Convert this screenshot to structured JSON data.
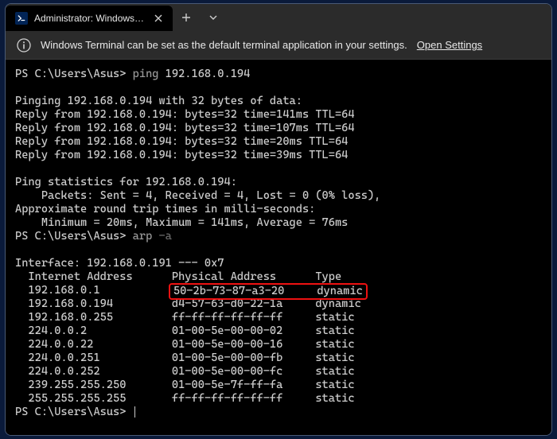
{
  "tab": {
    "title": "Administrator: Windows PowerS"
  },
  "infobar": {
    "message": "Windows Terminal can be set as the default terminal application in your settings.",
    "link": "Open Settings"
  },
  "session": {
    "prompt": "PS C:\\Users\\Asus>",
    "cmd_ping": "ping",
    "ping_target": "192.168.0.194",
    "ping_header": "Pinging 192.168.0.194 with 32 bytes of data:",
    "ping_replies": [
      "Reply from 192.168.0.194: bytes=32 time=141ms TTL=64",
      "Reply from 192.168.0.194: bytes=32 time=107ms TTL=64",
      "Reply from 192.168.0.194: bytes=32 time=20ms TTL=64",
      "Reply from 192.168.0.194: bytes=32 time=39ms TTL=64"
    ],
    "ping_stats_title": "Ping statistics for 192.168.0.194:",
    "ping_stats_packets": "    Packets: Sent = 4, Received = 4, Lost = 0 (0% loss),",
    "ping_rtt_title": "Approximate round trip times in milli-seconds:",
    "ping_rtt": "    Minimum = 20ms, Maximum = 141ms, Average = 76ms",
    "cmd_arp": "arp",
    "arp_flag": "-a",
    "arp_interface": "Interface: 192.168.0.191 --- 0x7",
    "arp_header": {
      "col1": "Internet Address",
      "col2": "Physical Address",
      "col3": "Type"
    },
    "arp_rows": [
      {
        "ip": "192.168.0.1",
        "mac": "50-2b-73-87-a3-20",
        "type": "dynamic",
        "highlight": true
      },
      {
        "ip": "192.168.0.194",
        "mac": "d4-57-63-d0-22-1a",
        "type": "dynamic",
        "highlight": false
      },
      {
        "ip": "192.168.0.255",
        "mac": "ff-ff-ff-ff-ff-ff",
        "type": "static",
        "highlight": false
      },
      {
        "ip": "224.0.0.2",
        "mac": "01-00-5e-00-00-02",
        "type": "static",
        "highlight": false
      },
      {
        "ip": "224.0.0.22",
        "mac": "01-00-5e-00-00-16",
        "type": "static",
        "highlight": false
      },
      {
        "ip": "224.0.0.251",
        "mac": "01-00-5e-00-00-fb",
        "type": "static",
        "highlight": false
      },
      {
        "ip": "224.0.0.252",
        "mac": "01-00-5e-00-00-fc",
        "type": "static",
        "highlight": false
      },
      {
        "ip": "239.255.255.250",
        "mac": "01-00-5e-7f-ff-fa",
        "type": "static",
        "highlight": false
      },
      {
        "ip": "255.255.255.255",
        "mac": "ff-ff-ff-ff-ff-ff",
        "type": "static",
        "highlight": false
      }
    ]
  }
}
